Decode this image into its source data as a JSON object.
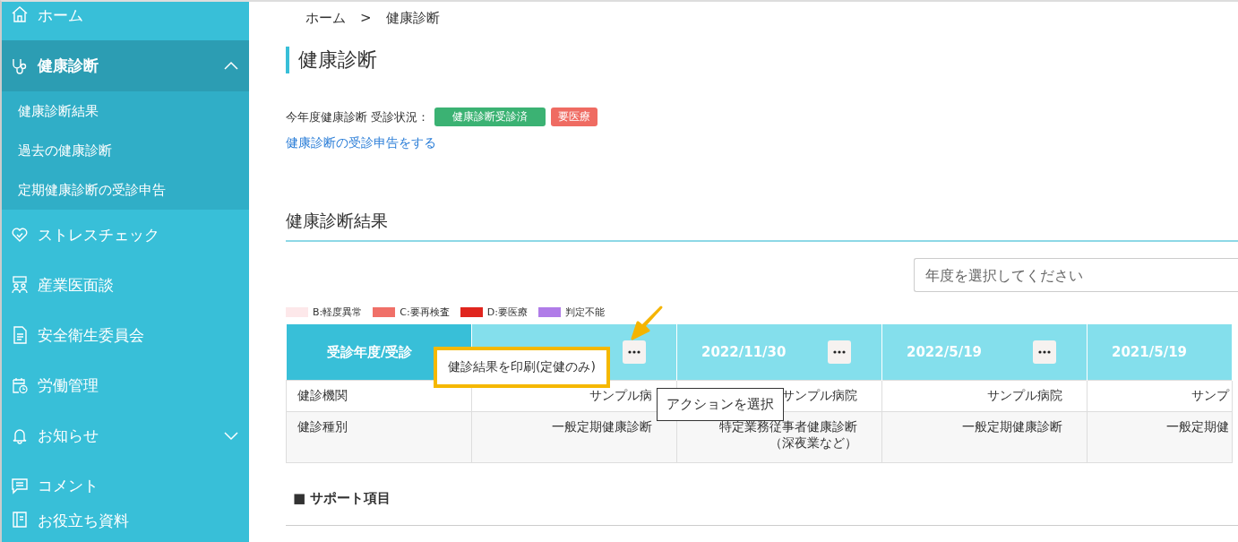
{
  "sidebar": {
    "items": [
      {
        "label": "ホーム"
      },
      {
        "label": "健康診断",
        "expanded": true,
        "children": [
          {
            "label": "健康診断結果"
          },
          {
            "label": "過去の健康診断"
          },
          {
            "label": "定期健康診断の受診申告"
          }
        ]
      },
      {
        "label": "ストレスチェック"
      },
      {
        "label": "産業医面談"
      },
      {
        "label": "安全衛生委員会"
      },
      {
        "label": "労働管理"
      },
      {
        "label": "お知らせ",
        "expanded": false
      },
      {
        "label": "コメント"
      },
      {
        "label": "お役立ち資料"
      }
    ]
  },
  "breadcrumb": [
    "ホーム",
    ">",
    "健康診断"
  ],
  "page_title": "健康診断",
  "status": {
    "label": "今年度健康診断 受診状況：",
    "badges": [
      {
        "text": "健康診断受診済",
        "color": "#3bb273"
      },
      {
        "text": "要医療",
        "color": "#ef6b62"
      }
    ]
  },
  "declare_link": "健康診断の受診申告をする",
  "section_title": "健康診断結果",
  "year_select": {
    "placeholder": "年度を選択してください"
  },
  "legend": [
    {
      "label": "B:軽度異常",
      "color": "#fde8ea"
    },
    {
      "label": "C:要再検査",
      "color": "#f07068"
    },
    {
      "label": "D:要医療",
      "color": "#e0251e"
    },
    {
      "label": "判定不能",
      "color": "#b07ce8"
    }
  ],
  "table": {
    "columns": [
      {
        "header": "受診年度/受診",
        "has_menu": false
      },
      {
        "has_menu": true
      },
      {
        "header": "2022/11/30",
        "has_menu": true
      },
      {
        "header": "2022/5/19",
        "has_menu": true
      },
      {
        "header": "2021/5/19",
        "has_menu": false
      }
    ],
    "rows": [
      {
        "cells": [
          "健診機関",
          "サンプル病",
          "サンプル病院",
          "サンプル病院",
          "サンプ"
        ]
      },
      {
        "cells": [
          "健診種別",
          "一般定期健康診断",
          "特定業務従事者健康診断（深夜業など）",
          "一般定期健康診断",
          "一般定期健"
        ]
      }
    ]
  },
  "popup": {
    "text": "健診結果を印刷(定健のみ)"
  },
  "tooltip": {
    "text": "アクションを選択"
  },
  "support_title": "■ サポート項目"
}
